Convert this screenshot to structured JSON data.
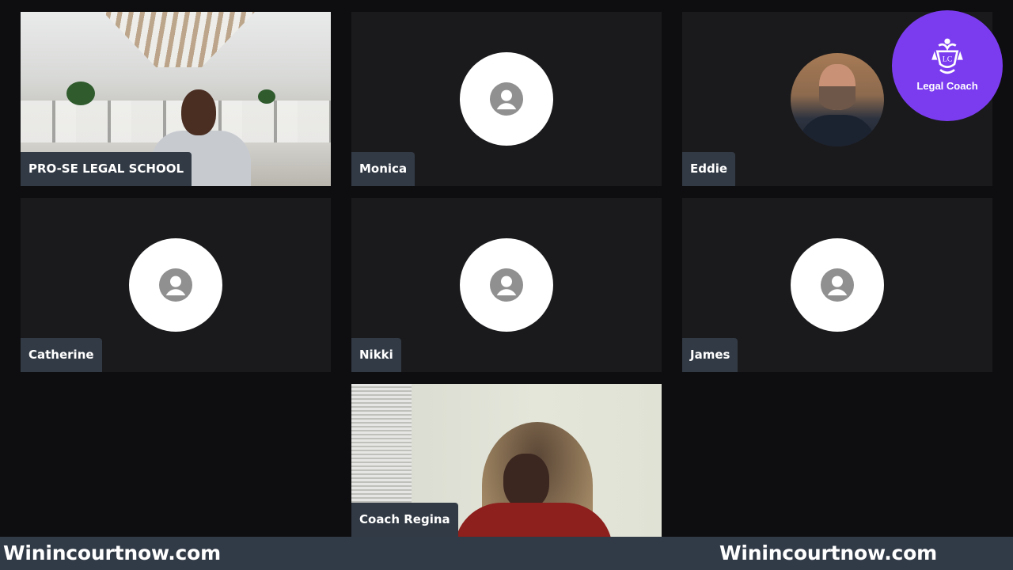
{
  "participants": [
    {
      "name": "PRO-SE LEGAL SCHOOL",
      "video": "office-presenter"
    },
    {
      "name": "Monica",
      "video": "avatar-placeholder"
    },
    {
      "name": "Eddie",
      "video": "profile-photo"
    },
    {
      "name": "Catherine",
      "video": "avatar-placeholder"
    },
    {
      "name": "Nikki",
      "video": "avatar-placeholder"
    },
    {
      "name": "James",
      "video": "avatar-placeholder"
    },
    {
      "name": "Coach Regina",
      "video": "webcam"
    }
  ],
  "logo": {
    "monogram": "LC",
    "text": "Legal Coach",
    "color": "#7b3cf0"
  },
  "footer": {
    "left_text": "Winincourtnow.com",
    "right_text": "Winincourtnow.com",
    "background": "#313a47"
  },
  "icons": {
    "avatar": "user-circle-icon"
  }
}
